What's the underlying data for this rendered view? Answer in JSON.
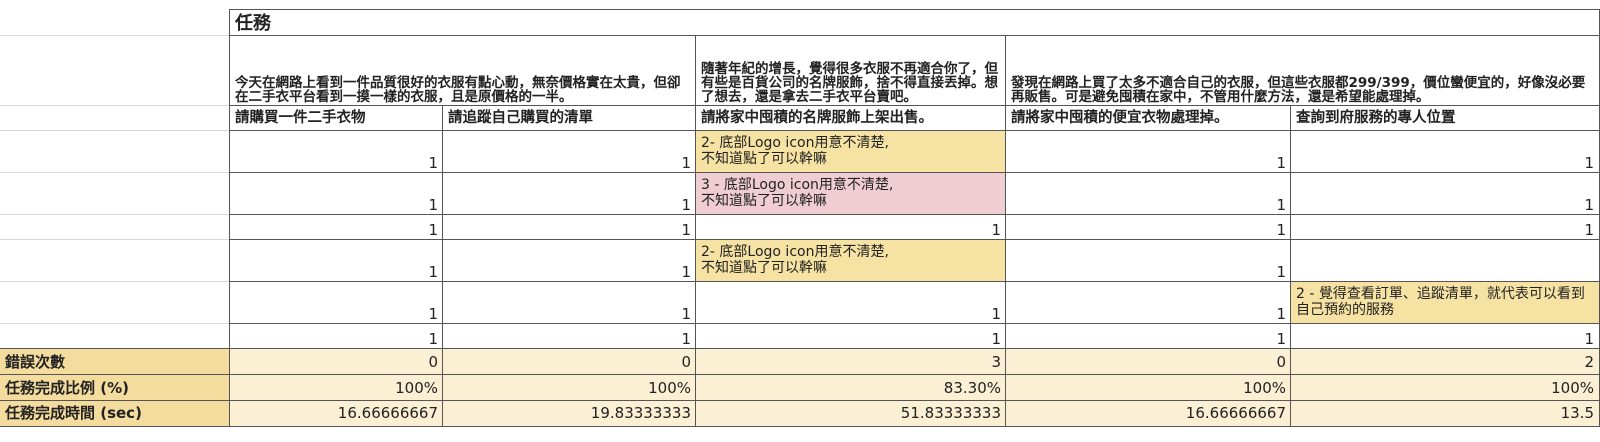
{
  "header": {
    "task_title": "任務"
  },
  "descriptions": {
    "d1": "今天在網路上看到一件品質很好的衣服有點心動，無奈價格實在太貴，但卻在二手衣平台看到一摸一樣的衣服，且是原價格的一半。",
    "d2": "隨著年紀的增長，覺得很多衣服不再適合你了，但有些是百貨公司的名牌服飾，捨不得直接丟掉。想了想去，還是拿去二手衣平台賣吧。",
    "d3": "發現在網路上買了太多不適合自己的衣服，但這些衣服都299/399，價位蠻便宜的，好像沒必要再販售。可是避免囤積在家中，不管用什麼方法，還是希望能處理掉。"
  },
  "columns": [
    "請購買一件二手衣物",
    "請追蹤自己購買的清單",
    "請將家中囤積的名牌服飾上架出售。",
    "請將家中囤積的便宜衣物處理掉。",
    "查詢到府服務的專人位置"
  ],
  "rows": [
    [
      "1",
      "1",
      "",
      "1",
      "1"
    ],
    [
      "1",
      "1",
      "",
      "1",
      "1"
    ],
    [
      "1",
      "1",
      "1",
      "1",
      "1"
    ],
    [
      "1",
      "1",
      "",
      "1",
      ""
    ],
    [
      "1",
      "1",
      "1",
      "1",
      ""
    ],
    [
      "1",
      "1",
      "1",
      "1",
      "1"
    ]
  ],
  "notes": {
    "r1c3": "2- 底部Logo icon用意不清楚,\n不知道點了可以幹嘛",
    "r2c3": "3 - 底部Logo icon用意不清楚,\n不知道點了可以幹嘛",
    "r4c3": "2- 底部Logo icon用意不清楚,\n不知道點了可以幹嘛",
    "r5c5": "2 - 覺得查看訂單、追蹤清單，就代表可以看到自己預約的服務"
  },
  "summary": [
    {
      "label": "錯誤次數",
      "values": [
        "0",
        "0",
        "3",
        "0",
        "2"
      ]
    },
    {
      "label": "任務完成比例 (%)",
      "values": [
        "100%",
        "100%",
        "83.30%",
        "100%",
        "100%"
      ]
    },
    {
      "label": "任務完成時間 (sec)",
      "values": [
        "16.66666667",
        "19.83333333",
        "51.83333333",
        "16.66666667",
        "13.5"
      ]
    }
  ],
  "colors": {
    "note_yellow": "#f6e2a2",
    "note_pink": "#f0cdd3",
    "label_fill": "#f3dc9d",
    "summary_fill": "#fbf0d4"
  }
}
